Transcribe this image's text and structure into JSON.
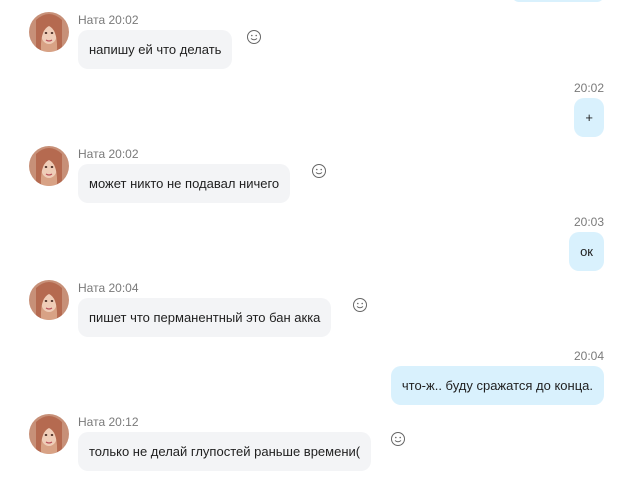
{
  "messages": [
    {
      "direction": "in",
      "sender": "Ната",
      "time": "20:02",
      "text": "напишу ей что делать"
    },
    {
      "direction": "out",
      "time": "20:02",
      "text": "+"
    },
    {
      "direction": "in",
      "sender": "Ната",
      "time": "20:02",
      "text": "может никто не подавал ничего"
    },
    {
      "direction": "out",
      "time": "20:03",
      "text": "ок"
    },
    {
      "direction": "in",
      "sender": "Ната",
      "time": "20:04",
      "text": "пишет что перманентный это бан акка"
    },
    {
      "direction": "out",
      "time": "20:04",
      "text": "что-ж.. буду сражатся до конца."
    },
    {
      "direction": "in",
      "sender": "Ната",
      "time": "20:12",
      "text": "только не делай глупостей раньше времени("
    }
  ],
  "colors": {
    "incoming_bubble": "#f3f4f6",
    "outgoing_bubble": "#d9f1fd",
    "meta_text": "#7a7a7a"
  },
  "icons": {
    "reaction": "smiley-face-icon",
    "more": "more-vertical-icon"
  }
}
